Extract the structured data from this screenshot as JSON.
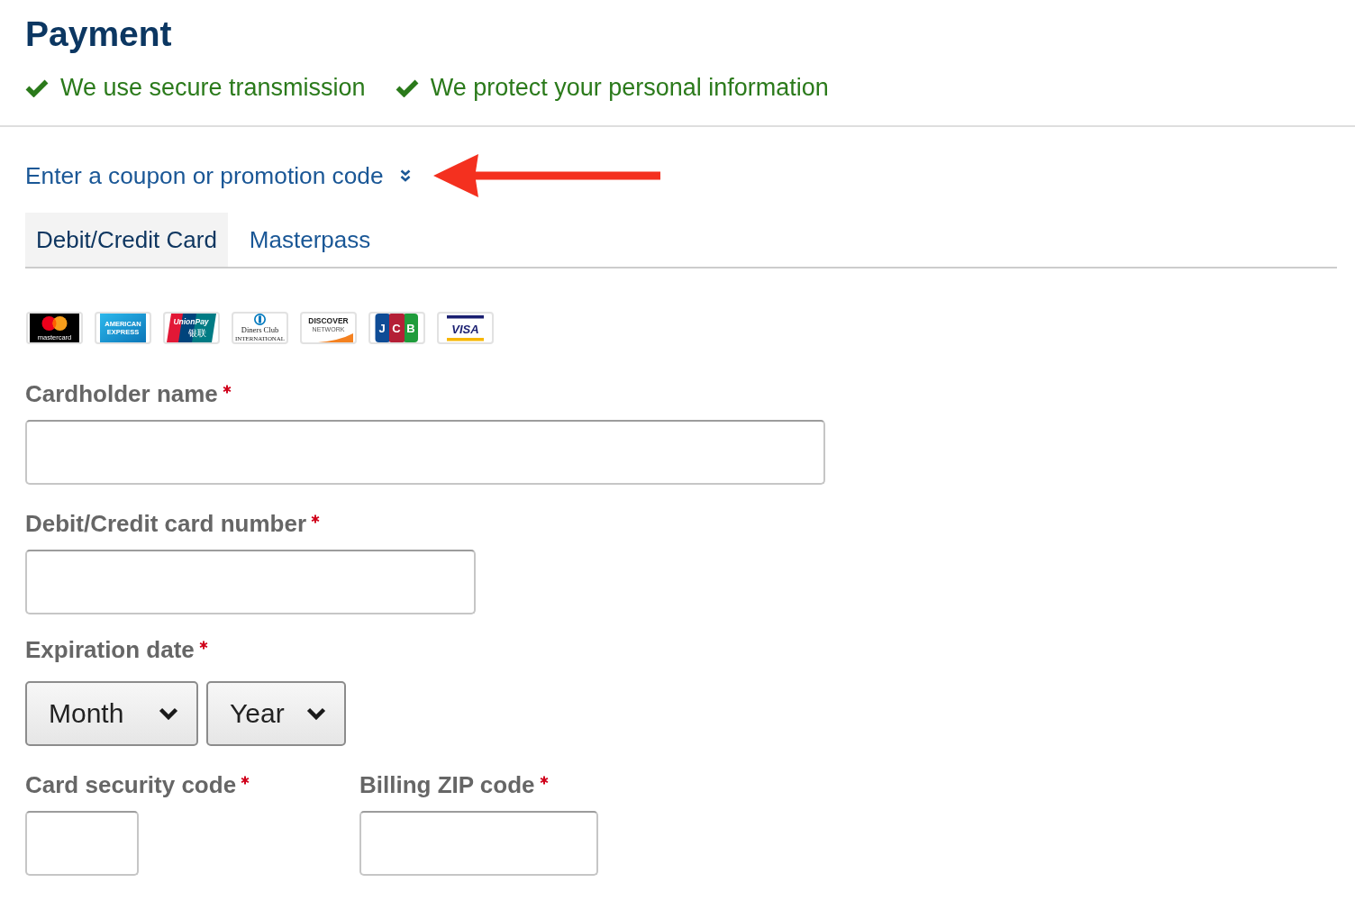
{
  "header": {
    "title": "Payment",
    "assurances": [
      {
        "text": "We use secure transmission"
      },
      {
        "text": "We protect your personal information"
      }
    ]
  },
  "coupon_link": {
    "label": "Enter a coupon or promotion code",
    "expanded": false
  },
  "annotations": [
    {
      "kind": "arrow"
    }
  ],
  "tabs": [
    {
      "label": "Debit/Credit Card",
      "selected": true
    },
    {
      "label": "Masterpass",
      "selected": false
    }
  ],
  "card_logos": [
    {
      "kind": "mastercard",
      "texts": [
        "mastercard"
      ]
    },
    {
      "kind": "amex",
      "texts": [
        "AMERICAN",
        "EXPRESS"
      ]
    },
    {
      "kind": "unionpay",
      "texts": [
        "UnionPay",
        "银联"
      ]
    },
    {
      "kind": "diners",
      "texts": [
        "Diners Club",
        "INTERNATIONAL"
      ]
    },
    {
      "kind": "discover",
      "texts": [
        "DISCOVER",
        "NETWORK"
      ]
    },
    {
      "kind": "jcb",
      "texts": [
        "JCB"
      ]
    },
    {
      "kind": "visa",
      "texts": [
        "VISA"
      ]
    }
  ],
  "form": {
    "cardholder_name": {
      "label": "Cardholder name",
      "required": true
    },
    "card_number": {
      "label": "Debit/Credit card number",
      "required": true
    },
    "expiration_date": {
      "label": "Expiration date",
      "required": true,
      "month": "Month",
      "year": "Year"
    },
    "security_code": {
      "label": "Card security code",
      "required": true
    },
    "billing_zip": {
      "label": "Billing ZIP code",
      "required": true
    }
  }
}
